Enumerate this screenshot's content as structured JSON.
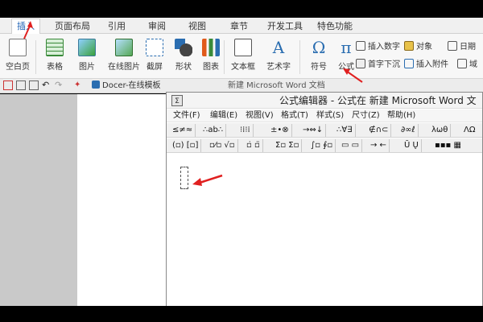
{
  "ribbon_tabs": [
    "插入",
    "页面布局",
    "引用",
    "审阅",
    "视图",
    "章节",
    "开发工具",
    "特色功能"
  ],
  "ribbon": {
    "blank_page": "空白页",
    "table": "表格",
    "picture": "图片",
    "online_picture": "在线图片",
    "screenshot": "截屏",
    "shape": "形状",
    "chart": "图表",
    "textbox": "文本框",
    "art_text": "艺术字",
    "symbol": "符号",
    "formula": "公式",
    "insert_number": "插入数字",
    "object": "对象",
    "drop_cap": "首字下沉",
    "insert_attachment": "插入附件",
    "date": "日期",
    "field": "域"
  },
  "quick": {
    "docer_tab": "Docer-在线模板",
    "doc_tab": "新建 Microsoft Word 文档"
  },
  "equation_editor": {
    "icon_text": "Σ",
    "title": "公式编辑器 - 公式在 新建 Microsoft Word 文",
    "menu": [
      "文件(F)",
      "编辑(E)",
      "视图(V)",
      "格式(T)",
      "样式(S)",
      "尺寸(Z)",
      "帮助(H)"
    ],
    "palette_row1": [
      "≤≠≈",
      "∴ab∴",
      "⁝⁞⁝⁞",
      "±•⊗",
      "→⇔↓",
      "∴∀∃",
      "∉∩⊂",
      "∂∞ℓ",
      "λωθ",
      "ΛΩ"
    ],
    "palette_row2": [
      "(▫) [▫]",
      "▫⁄▫ √▫",
      "▫̇ ▫̈",
      "Σ▫ Σ▫",
      "∫▫ ∮▫",
      "▭ ▭",
      "→ ←",
      "Ū Ų",
      "▪▪▪ ▦"
    ]
  },
  "colors": {
    "accent_blue": "#1a5fb4",
    "arrow_red": "#e02020",
    "workspace_gray": "#c9c9c9"
  }
}
